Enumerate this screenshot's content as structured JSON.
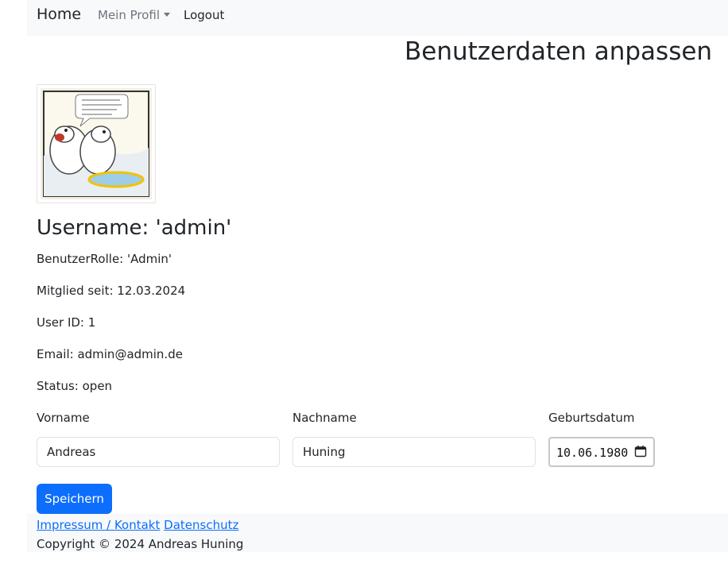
{
  "navbar": {
    "brand": "Home",
    "profile_menu": "Mein Profil",
    "logout": "Logout"
  },
  "page": {
    "title": "Benutzerdaten anpassen"
  },
  "profile": {
    "avatar_icon": "profile-cartoon-image",
    "username_line": "Username: 'admin'",
    "role_line": "BenutzerRolle: 'Admin'",
    "member_since_line": "Mitglied seit: 12.03.2024",
    "user_id_line": "User ID: 1",
    "email_line": "Email: admin@admin.de",
    "status_line": "Status: open"
  },
  "form": {
    "vorname_label": "Vorname",
    "vorname_value": "Andreas",
    "nachname_label": "Nachname",
    "nachname_value": "Huning",
    "geburtsdatum_label": "Geburtsdatum",
    "geburtsdatum_value": "10.06.1980",
    "save_label": "Speichern"
  },
  "footer": {
    "impressum_link": "Impressum / Kontakt",
    "datenschutz_link": "Datenschutz",
    "copyright": "Copyright © 2024 Andreas Huning"
  },
  "colors": {
    "primary": "#0d6efd",
    "navbar_bg": "#f8f9fa",
    "text": "#212529",
    "muted": "#6c757d"
  }
}
